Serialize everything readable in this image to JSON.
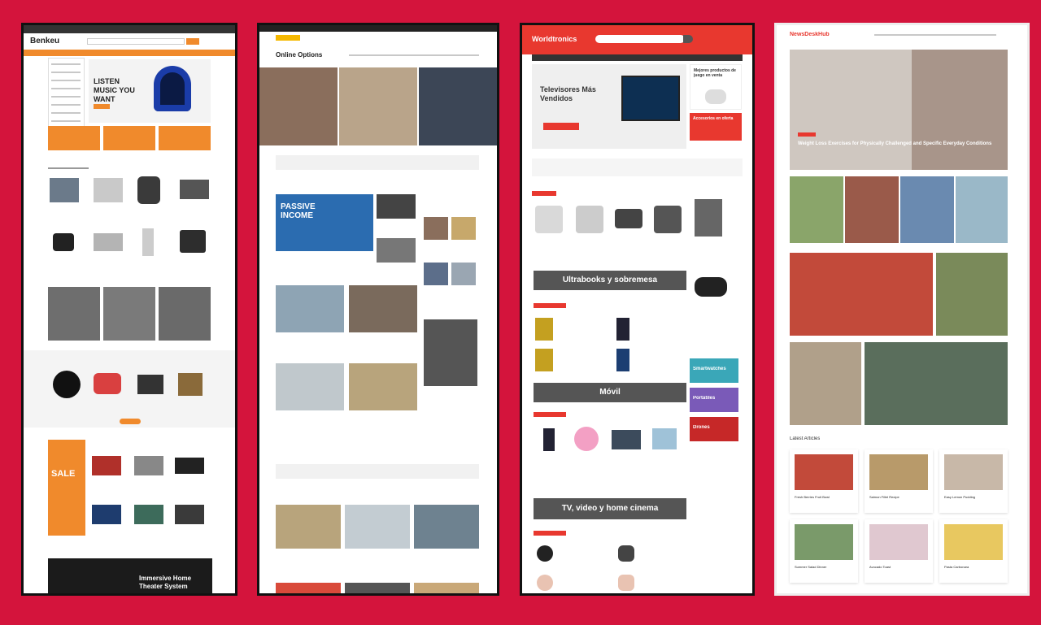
{
  "panel1": {
    "logo": "Benkeu",
    "hero_headline": "LISTEN MUSIC YOU WANT",
    "promo_badge": "Immersive Home Theater System",
    "sale_tag": "SALE",
    "colors": {
      "accent": "#f08a2c",
      "dark": "#222222"
    }
  },
  "panel2": {
    "logo": "Online Options",
    "feature_banner": "PASSIVE INCOME",
    "colors": {
      "accent": "#f5b800",
      "red": "#e8453c"
    }
  },
  "panel3": {
    "logo": "Worldtronics",
    "hero_title": "Televisores Más Vendidos",
    "side_headline": "Mejores productos de juego en venta",
    "side_headline_2": "Accesorios en oferta",
    "section_desktop": "Ultrabooks y sobremesa",
    "section_mobile": "Móvil",
    "section_tv": "TV, video y home cinema",
    "side_tiles": [
      "Smartwatches",
      "Portátiles",
      "Drones"
    ],
    "colors": {
      "accent": "#e8382f",
      "dark": "#555555"
    }
  },
  "panel4": {
    "logo": "NewsDeskHub",
    "hero_caption": "Weight Loss Exercises for Physically Challenged and Specific Everyday Conditions",
    "section_title": "Latest Articles",
    "cards": [
      "Fresh Berries Fruit Bowl",
      "Salmon Fillet Recipe",
      "Easy Lemon Pudding",
      "Summer Salad Dinner",
      "Avocado Toast",
      "Pasta Carbonara"
    ],
    "colors": {
      "accent": "#e8382f"
    }
  }
}
